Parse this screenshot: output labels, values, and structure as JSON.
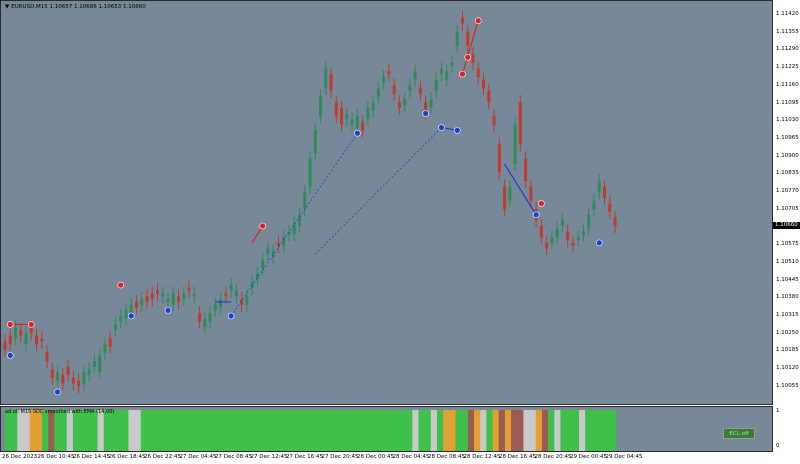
{
  "chart": {
    "symbol": "EURUSD,M15",
    "ohlc": "1.10657 1.10686 1.10653 1.10660",
    "current_price": "1.10660",
    "price_labels": [
      "1.11420",
      "1.11355",
      "1.11290",
      "1.11225",
      "1.11160",
      "1.11095",
      "1.11030",
      "1.10965",
      "1.10900",
      "1.10835",
      "1.10770",
      "1.10705",
      "1.10640",
      "1.10575",
      "1.10510",
      "1.10445",
      "1.10380",
      "1.10315",
      "1.10250",
      "1.10185",
      "1.10120",
      "1.10055"
    ],
    "time_labels": [
      "26 Dec 2023",
      "26 Dec 10:45",
      "26 Dec 14:45",
      "26 Dec 18:45",
      "26 Dec 22:45",
      "27 Dec 04:45",
      "27 Dec 08:45",
      "27 Dec 12:45",
      "27 Dec 16:45",
      "27 Dec 20:45",
      "28 Dec 00:45",
      "28 Dec 04:45",
      "28 Dec 08:45",
      "28 Dec 12:45",
      "28 Dec 16:45",
      "28 Dec 20:45",
      "29 Dec 00:45",
      "29 Dec 04:45"
    ],
    "colors": {
      "bull": "#2e8b57",
      "bear": "#c0392b",
      "up_marker": "#e02020",
      "down_marker": "#1a3fd0",
      "bg": "#778899"
    },
    "price_range": [
      1.1002,
      1.1146
    ]
  },
  "indicator": {
    "label": "ad ol: M15 SDC smoothed with EMA (14,00)",
    "button_label": "ECL-off",
    "axis_max": "1",
    "axis_min": "0",
    "colors": {
      "green": "#3fc04a",
      "orange": "#e2a033",
      "gray": "#c9c9c9",
      "brown": "#9a5b55"
    }
  },
  "chart_data": {
    "type": "candlestick",
    "title": "EURUSD,M15",
    "points": [
      [
        1.1025,
        1.1022
      ],
      [
        1.1027,
        1.1024
      ],
      [
        1.1026,
        1.103
      ],
      [
        1.1029,
        1.1027
      ],
      [
        1.1024,
        1.1028
      ],
      [
        1.103,
        1.1028
      ],
      [
        1.1027,
        1.1024
      ],
      [
        1.1026,
        1.1025
      ],
      [
        1.1021,
        1.1018
      ],
      [
        1.1015,
        1.1012
      ],
      [
        1.1011,
        1.1014
      ],
      [
        1.1013,
        1.101
      ],
      [
        1.1016,
        1.1013
      ],
      [
        1.1012,
        1.101
      ],
      [
        1.1011,
        1.1009
      ],
      [
        1.101,
        1.1014
      ],
      [
        1.1013,
        1.1015
      ],
      [
        1.1016,
        1.1018
      ],
      [
        1.1014,
        1.102
      ],
      [
        1.1021,
        1.1024
      ],
      [
        1.1026,
        1.1023
      ],
      [
        1.1029,
        1.1031
      ],
      [
        1.1032,
        1.1034
      ],
      [
        1.1033,
        1.1036
      ],
      [
        1.1035,
        1.1038
      ],
      [
        1.1039,
        1.1037
      ],
      [
        1.1038,
        1.104
      ],
      [
        1.1041,
        1.1039
      ],
      [
        1.1042,
        1.104
      ],
      [
        1.1043,
        1.1042
      ],
      [
        1.1041,
        1.1042
      ],
      [
        1.1039,
        1.104
      ],
      [
        1.1038,
        1.1042
      ],
      [
        1.1041,
        1.1039
      ],
      [
        1.104,
        1.1042
      ],
      [
        1.1044,
        1.1043
      ],
      [
        1.1041,
        1.1042
      ],
      [
        1.1035,
        1.1032
      ],
      [
        1.103,
        1.1033
      ],
      [
        1.1032,
        1.1035
      ],
      [
        1.1036,
        1.1038
      ],
      [
        1.1037,
        1.104
      ],
      [
        1.1042,
        1.1041
      ],
      [
        1.1043,
        1.1045
      ],
      [
        1.1041,
        1.1043
      ],
      [
        1.104,
        1.1038
      ],
      [
        1.1038,
        1.1041
      ],
      [
        1.1044,
        1.1046
      ],
      [
        1.1047,
        1.1049
      ],
      [
        1.1051,
        1.1054
      ],
      [
        1.1056,
        1.1058
      ],
      [
        1.1055,
        1.1057
      ],
      [
        1.106,
        1.1059
      ],
      [
        1.1059,
        1.1062
      ],
      [
        1.1063,
        1.1064
      ],
      [
        1.1063,
        1.1067
      ],
      [
        1.1066,
        1.107
      ],
      [
        1.1072,
        1.1078
      ],
      [
        1.108,
        1.109
      ],
      [
        1.1092,
        1.11
      ],
      [
        1.1105,
        1.1112
      ],
      [
        1.1115,
        1.1122
      ],
      [
        1.112,
        1.1114
      ],
      [
        1.111,
        1.1105
      ],
      [
        1.1108,
        1.1102
      ],
      [
        1.1104,
        1.1106
      ],
      [
        1.1102,
        1.1104
      ],
      [
        1.1101,
        1.1105
      ],
      [
        1.1103,
        1.11
      ],
      [
        1.1104,
        1.1108
      ],
      [
        1.1107,
        1.111
      ],
      [
        1.1112,
        1.1115
      ],
      [
        1.1117,
        1.1119
      ],
      [
        1.1121,
        1.112
      ],
      [
        1.1116,
        1.1113
      ],
      [
        1.111,
        1.1108
      ],
      [
        1.1109,
        1.1111
      ],
      [
        1.1114,
        1.1116
      ],
      [
        1.1118,
        1.1121
      ],
      [
        1.1115,
        1.1113
      ],
      [
        1.111,
        1.1106
      ],
      [
        1.1108,
        1.1111
      ],
      [
        1.1114,
        1.1118
      ],
      [
        1.112,
        1.1122
      ],
      [
        1.1118,
        1.1121
      ],
      [
        1.1123,
        1.1124
      ],
      [
        1.113,
        1.1135
      ],
      [
        1.114,
        1.1138
      ],
      [
        1.1135,
        1.113
      ],
      [
        1.1127,
        1.1124
      ],
      [
        1.1122,
        1.1119
      ],
      [
        1.1118,
        1.1115
      ],
      [
        1.1114,
        1.111
      ],
      [
        1.1105,
        1.1102
      ],
      [
        1.1095,
        1.1085
      ],
      [
        1.108,
        1.1072
      ],
      [
        1.1075,
        1.108
      ],
      [
        1.1088,
        1.1102
      ],
      [
        1.111,
        1.1095
      ],
      [
        1.109,
        1.1082
      ],
      [
        1.108,
        1.1075
      ],
      [
        1.1072,
        1.1068
      ],
      [
        1.1066,
        1.1062
      ],
      [
        1.106,
        1.1058
      ],
      [
        1.106,
        1.1062
      ],
      [
        1.1062,
        1.1065
      ],
      [
        1.1066,
        1.1068
      ],
      [
        1.1064,
        1.1061
      ],
      [
        1.106,
        1.1059
      ],
      [
        1.1061,
        1.1062
      ],
      [
        1.1063,
        1.1064
      ],
      [
        1.1065,
        1.107
      ],
      [
        1.1072,
        1.1075
      ],
      [
        1.1078,
        1.1082
      ],
      [
        1.108,
        1.1076
      ],
      [
        1.1074,
        1.1071
      ],
      [
        1.1069,
        1.1066
      ]
    ],
    "up_markers": [
      [
        1,
        1.1031
      ],
      [
        5,
        1.1031
      ],
      [
        22,
        1.1045
      ],
      [
        49,
        1.1066
      ],
      [
        87,
        1.112
      ],
      [
        88,
        1.1126
      ],
      [
        90,
        1.1139
      ],
      [
        102,
        1.1074
      ]
    ],
    "down_markers": [
      [
        1,
        1.102
      ],
      [
        10,
        1.1007
      ],
      [
        24,
        1.1034
      ],
      [
        31,
        1.1036
      ],
      [
        43,
        1.1034
      ],
      [
        67,
        1.1099
      ],
      [
        80,
        1.1106
      ],
      [
        83,
        1.1101
      ],
      [
        86,
        1.11
      ],
      [
        101,
        1.107
      ],
      [
        113,
        1.106
      ]
    ],
    "ind_colors": [
      "g",
      "g",
      "gr",
      "gr",
      "o",
      "o",
      "g",
      "br",
      "g",
      "g",
      "gr",
      "g",
      "g",
      "g",
      "g",
      "gr",
      "g",
      "g",
      "g",
      "g",
      "gr",
      "gr",
      "g",
      "g",
      "g",
      "g",
      "g",
      "g",
      "g",
      "g",
      "g",
      "g",
      "g",
      "g",
      "g",
      "g",
      "g",
      "g",
      "g",
      "g",
      "g",
      "g",
      "g",
      "g",
      "g",
      "g",
      "g",
      "g",
      "g",
      "g",
      "g",
      "g",
      "g",
      "g",
      "g",
      "g",
      "g",
      "g",
      "g",
      "g",
      "g",
      "g",
      "g",
      "g",
      "g",
      "g",
      "gr",
      "g",
      "g",
      "gr",
      "g",
      "o",
      "o",
      "g",
      "g",
      "br",
      "o",
      "gr",
      "g",
      "o",
      "br",
      "o",
      "br",
      "br",
      "gr",
      "gr",
      "o",
      "br",
      "g",
      "gr",
      "g",
      "g",
      "g",
      "gr",
      "g",
      "g",
      "g",
      "g",
      "g"
    ],
    "ylim": [
      1.1002,
      1.1146
    ]
  }
}
